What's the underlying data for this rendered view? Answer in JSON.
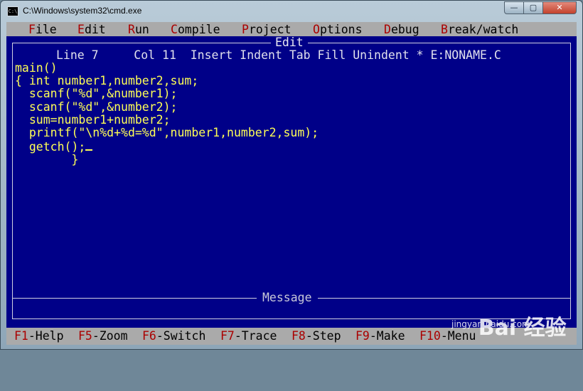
{
  "window": {
    "title": "C:\\Windows\\system32\\cmd.exe",
    "icon_label": "C:\\",
    "minimize_glyph": "—",
    "maximize_glyph": "▢",
    "close_glyph": "✕"
  },
  "menu": [
    {
      "hot": "F",
      "rest": "ile"
    },
    {
      "hot": "E",
      "rest": "dit"
    },
    {
      "hot": "R",
      "rest": "un"
    },
    {
      "hot": "C",
      "rest": "ompile"
    },
    {
      "hot": "P",
      "rest": "roject"
    },
    {
      "hot": "O",
      "rest": "ptions"
    },
    {
      "hot": "D",
      "rest": "ebug"
    },
    {
      "hot": "B",
      "rest": "reak/watch"
    }
  ],
  "editor": {
    "title": "Edit",
    "status": "Line 7     Col 11  Insert Indent Tab Fill Unindent * E:NONAME.C",
    "code_lines": [
      "main()",
      "{ int number1,number2,sum;",
      "  scanf(\"%d\",&number1);",
      "  scanf(\"%d\",&number2);",
      "  sum=number1+number2;",
      "  printf(\"\\n%d+%d=%d\",number1,number2,sum);",
      "  getch();",
      "        }"
    ],
    "cursor_line": 6
  },
  "message": {
    "title": "Message"
  },
  "function_keys": [
    {
      "key": "F1",
      "label": "-Help"
    },
    {
      "key": "F5",
      "label": "-Zoom"
    },
    {
      "key": "F6",
      "label": "-Switch"
    },
    {
      "key": "F7",
      "label": "-Trace"
    },
    {
      "key": "F8",
      "label": "-Step"
    },
    {
      "key": "F9",
      "label": "-Make"
    },
    {
      "key": "F10",
      "label": "-Menu"
    }
  ],
  "watermark": {
    "text": "Bai 经验",
    "url": "jingyan.baidu.com"
  },
  "colors": {
    "editor_bg": "#000088",
    "code_text": "#ffff55",
    "menu_bg": "#aaaaaa",
    "hotkey": "#aa0000"
  }
}
